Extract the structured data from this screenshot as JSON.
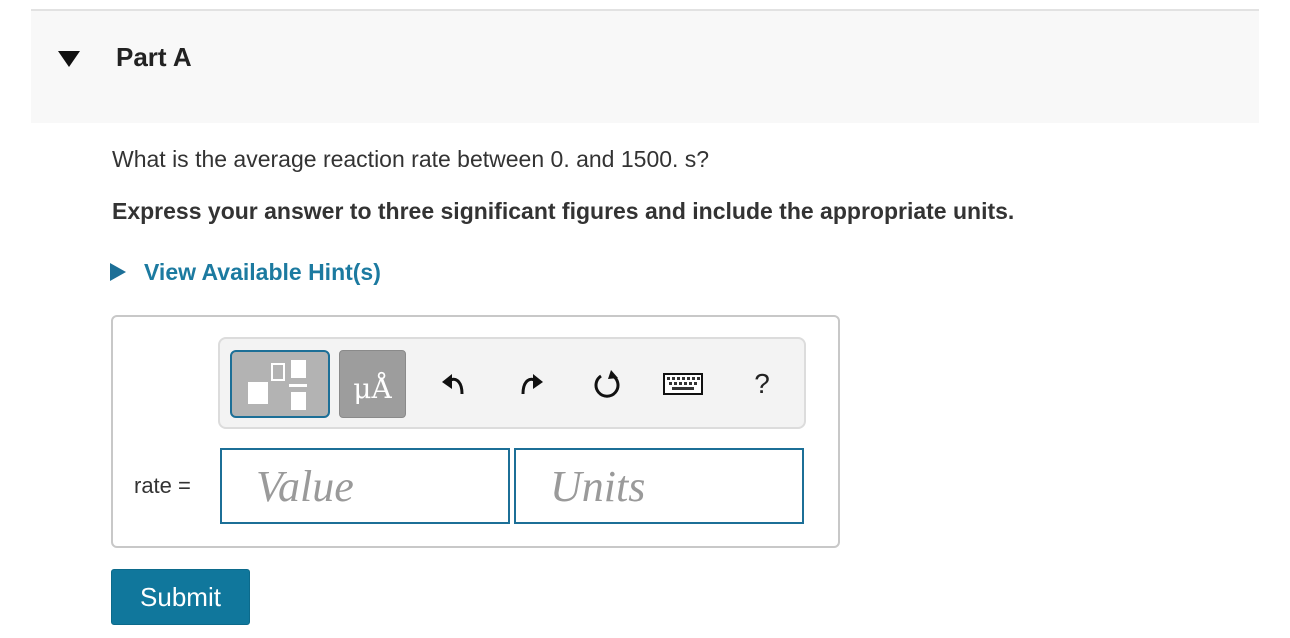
{
  "part": {
    "title": "Part A"
  },
  "question": {
    "text": "What is the average reaction rate between 0. and 1500. s?",
    "instruction": "Express your answer to three significant figures and include the appropriate units."
  },
  "hint": {
    "label": "View Available Hint(s)"
  },
  "toolbar": {
    "units_label": "μÅ",
    "help_label": "?"
  },
  "answer": {
    "label": "rate =",
    "value_placeholder": "Value",
    "units_placeholder": "Units"
  },
  "submit_label": "Submit",
  "colors": {
    "accent": "#10779c",
    "link": "#1c7aa0",
    "field_border": "#1c6f97"
  }
}
